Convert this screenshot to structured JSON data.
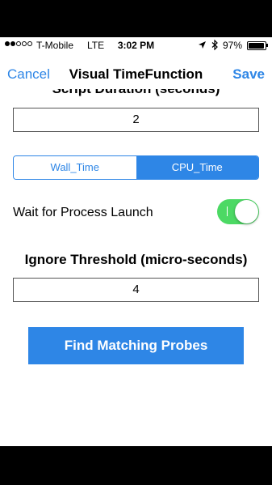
{
  "status_bar": {
    "carrier": "T-Mobile",
    "network": "LTE",
    "time": "3:02 PM",
    "battery_percent": "97%",
    "signal_bars_filled": 2,
    "signal_bars_total": 5
  },
  "nav": {
    "cancel_label": "Cancel",
    "title": "Visual TimeFunction",
    "save_label": "Save"
  },
  "form": {
    "duration_label": "Script Duration (seconds)",
    "duration_value": "2",
    "time_mode": {
      "options": [
        "Wall_Time",
        "CPU_Time"
      ],
      "selected": "CPU_Time"
    },
    "wait_label": "Wait for Process Launch",
    "wait_enabled": true,
    "threshold_label": "Ignore Threshold (micro-seconds)",
    "threshold_value": "4",
    "find_button_label": "Find Matching Probes"
  },
  "colors": {
    "accent": "#2e86e6",
    "toggle_on": "#4cd964"
  },
  "icons": [
    "location-arrow-icon",
    "bluetooth-icon",
    "battery-icon"
  ]
}
